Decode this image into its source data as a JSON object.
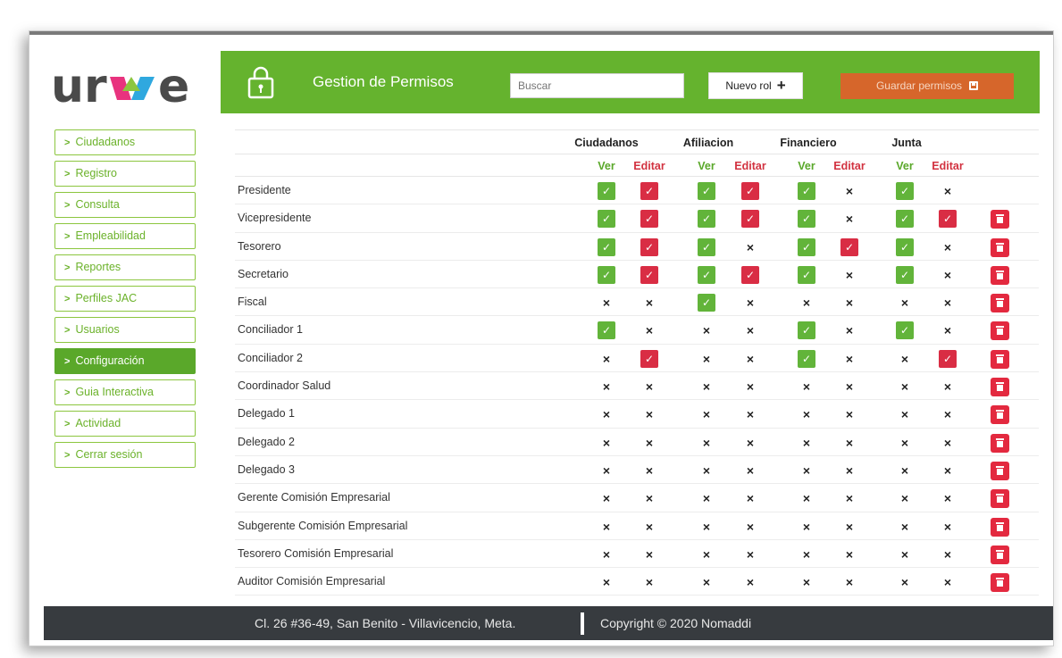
{
  "brand": {
    "logo_text": "urve"
  },
  "sidebar": {
    "items": [
      {
        "label": "Ciudadanos",
        "active": false
      },
      {
        "label": "Registro",
        "active": false
      },
      {
        "label": "Consulta",
        "active": false
      },
      {
        "label": "Empleabilidad",
        "active": false
      },
      {
        "label": "Reportes",
        "active": false
      },
      {
        "label": "Perfiles JAC",
        "active": false
      },
      {
        "label": "Usuarios",
        "active": false
      },
      {
        "label": "Configuración",
        "active": true
      },
      {
        "label": "Guia Interactiva",
        "active": false
      },
      {
        "label": "Actividad",
        "active": false
      },
      {
        "label": "Cerrar sesión",
        "active": false
      }
    ]
  },
  "header": {
    "title": "Gestion de Permisos",
    "search_placeholder": "Buscar",
    "new_role_label": "Nuevo rol",
    "save_label": "Guardar permisos"
  },
  "permissions": {
    "groups": [
      "Ciudadanos",
      "Afiliacion",
      "Financiero",
      "Junta"
    ],
    "sub_labels": {
      "view": "Ver",
      "edit": "Editar"
    },
    "rows": [
      {
        "role": "Presidente",
        "perms": [
          1,
          1,
          1,
          1,
          1,
          0,
          1,
          0
        ],
        "deletable": false
      },
      {
        "role": "Vicepresidente",
        "perms": [
          1,
          1,
          1,
          1,
          1,
          0,
          1,
          1
        ],
        "deletable": true
      },
      {
        "role": "Tesorero",
        "perms": [
          1,
          1,
          1,
          0,
          1,
          1,
          1,
          0
        ],
        "deletable": true
      },
      {
        "role": "Secretario",
        "perms": [
          1,
          1,
          1,
          1,
          1,
          0,
          1,
          0
        ],
        "deletable": true
      },
      {
        "role": "Fiscal",
        "perms": [
          0,
          0,
          1,
          0,
          0,
          0,
          0,
          0
        ],
        "deletable": true
      },
      {
        "role": "Conciliador 1",
        "perms": [
          1,
          0,
          0,
          0,
          1,
          0,
          1,
          0
        ],
        "deletable": true
      },
      {
        "role": "Conciliador 2",
        "perms": [
          0,
          1,
          0,
          0,
          1,
          0,
          0,
          1
        ],
        "deletable": true
      },
      {
        "role": "Coordinador Salud",
        "perms": [
          0,
          0,
          0,
          0,
          0,
          0,
          0,
          0
        ],
        "deletable": true
      },
      {
        "role": "Delegado 1",
        "perms": [
          0,
          0,
          0,
          0,
          0,
          0,
          0,
          0
        ],
        "deletable": true
      },
      {
        "role": "Delegado 2",
        "perms": [
          0,
          0,
          0,
          0,
          0,
          0,
          0,
          0
        ],
        "deletable": true
      },
      {
        "role": "Delegado 3",
        "perms": [
          0,
          0,
          0,
          0,
          0,
          0,
          0,
          0
        ],
        "deletable": true
      },
      {
        "role": "Gerente Comisión Empresarial",
        "perms": [
          0,
          0,
          0,
          0,
          0,
          0,
          0,
          0
        ],
        "deletable": true
      },
      {
        "role": "Subgerente Comisión Empresarial",
        "perms": [
          0,
          0,
          0,
          0,
          0,
          0,
          0,
          0
        ],
        "deletable": true
      },
      {
        "role": "Tesorero Comisión Empresarial",
        "perms": [
          0,
          0,
          0,
          0,
          0,
          0,
          0,
          0
        ],
        "deletable": true
      },
      {
        "role": "Auditor Comisión Empresarial",
        "perms": [
          0,
          0,
          0,
          0,
          0,
          0,
          0,
          0
        ],
        "deletable": true
      }
    ]
  },
  "footer": {
    "address": "Cl. 26 #36-49, San Benito - Villavicencio, Meta.",
    "copyright": "Copyright © 2020 Nomaddi"
  },
  "colors": {
    "brand_green": "#65b32e",
    "check_green": "#62b43a",
    "edit_red": "#d92d44",
    "save_orange": "#d6662b",
    "footer_dark": "#373b3f"
  }
}
